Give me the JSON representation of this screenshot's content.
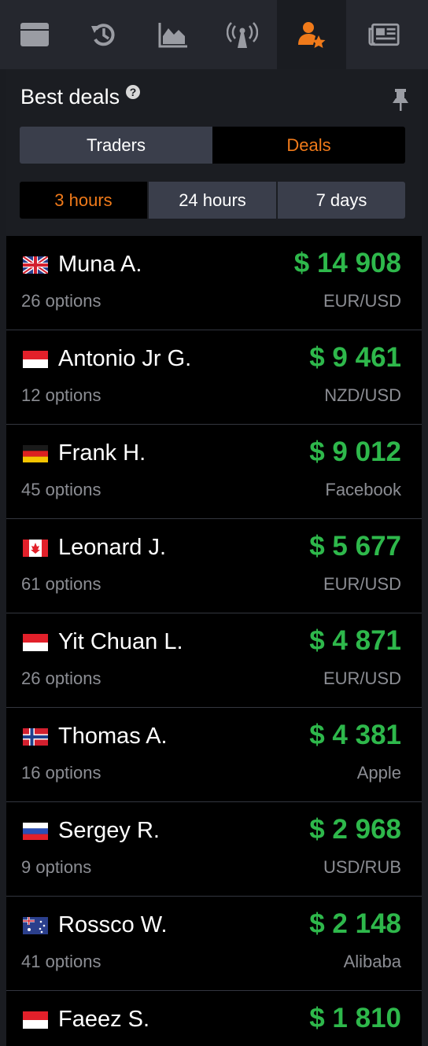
{
  "top_tabs": [
    {
      "icon": "window-icon",
      "active": false
    },
    {
      "icon": "history-icon",
      "active": false
    },
    {
      "icon": "chart-icon",
      "active": false
    },
    {
      "icon": "signal-tower-icon",
      "active": false
    },
    {
      "icon": "user-star-icon",
      "active": true
    },
    {
      "icon": "newspaper-icon",
      "active": false
    }
  ],
  "panel": {
    "title": "Best deals",
    "help_glyph": "?",
    "segment_view": {
      "traders_label": "Traders",
      "deals_label": "Deals",
      "selected": "Deals"
    },
    "segment_period": {
      "labels": [
        "3 hours",
        "24 hours",
        "7 days"
      ],
      "selected": "3 hours"
    }
  },
  "colors": {
    "accent_orange": "#f07a1a",
    "profit_green": "#2eb84b",
    "muted_text": "#8b8d93"
  },
  "deals": [
    {
      "flag": "uk",
      "name": "Muna A.",
      "amount": "$ 14 908",
      "options": "26 options",
      "asset": "EUR/USD"
    },
    {
      "flag": "monaco",
      "name": "Antonio Jr G.",
      "amount": "$ 9 461",
      "options": "12 options",
      "asset": "NZD/USD"
    },
    {
      "flag": "germany",
      "name": "Frank H.",
      "amount": "$ 9 012",
      "options": "45 options",
      "asset": "Facebook"
    },
    {
      "flag": "canada",
      "name": "Leonard J.",
      "amount": "$ 5 677",
      "options": "61 options",
      "asset": "EUR/USD"
    },
    {
      "flag": "monaco",
      "name": "Yit Chuan L.",
      "amount": "$ 4 871",
      "options": "26 options",
      "asset": "EUR/USD"
    },
    {
      "flag": "norway",
      "name": "Thomas A.",
      "amount": "$ 4 381",
      "options": "16 options",
      "asset": "Apple"
    },
    {
      "flag": "russia",
      "name": "Sergey R.",
      "amount": "$ 2 968",
      "options": "9 options",
      "asset": "USD/RUB"
    },
    {
      "flag": "australia",
      "name": "Rossco W.",
      "amount": "$ 2 148",
      "options": "41 options",
      "asset": "Alibaba"
    },
    {
      "flag": "monaco",
      "name": "Faeez S.",
      "amount": "$ 1 810",
      "options": "",
      "asset": ""
    }
  ]
}
